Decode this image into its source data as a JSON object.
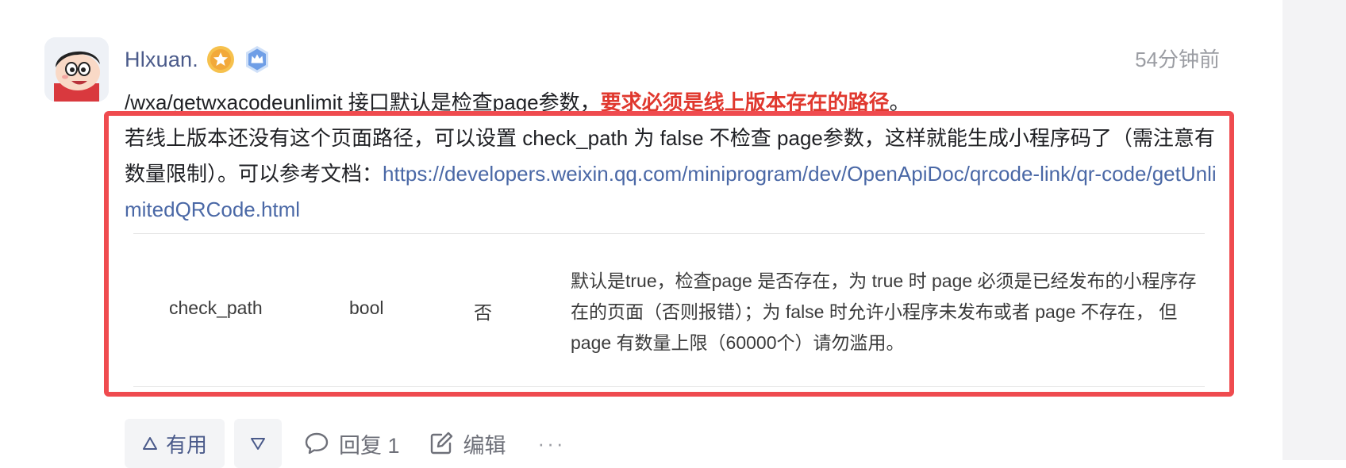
{
  "comment": {
    "author": "Hlxuan.",
    "timestamp": "54分钟前",
    "line1_prefix": "/wxa/getwxacodeunlimit 接口默认是检查page参数，",
    "line1_emphasis": "要求必须是线上版本存在的路径",
    "line1_suffix": "。",
    "para_text": "若线上版本还没有这个页面路径，可以设置 check_path 为 false 不检查 page参数，这样就能生成小程序码了（需注意有数量限制）。可以参考文档：",
    "doc_link": "https://developers.weixin.qq.com/miniprogram/dev/OpenApiDoc/qrcode-link/qr-code/getUnlimitedQRCode.html"
  },
  "param_table": {
    "rows": [
      {
        "name": "check_path",
        "type": "bool",
        "required": "否",
        "description": "默认是true，检查page 是否存在，为 true 时 page 必须是已经发布的小程序存在的页面（否则报错）；为 false 时允许小程序未发布或者 page 不存在， 但page 有数量上限（60000个）请勿滥用。"
      }
    ]
  },
  "actions": {
    "useful_label": "有用",
    "reply_label": "回复 1",
    "edit_label": "编辑",
    "more_label": "···"
  },
  "colors": {
    "highlight_border": "#ef4b4f",
    "emphasis": "#e0382e",
    "link": "#4a68a6",
    "author": "#4a5a8a"
  },
  "icons": [
    "avatar-image",
    "gold-star-badge",
    "blue-crown-badge",
    "thumbs-up-triangle-icon",
    "down-triangle-icon",
    "comment-bubble-icon",
    "edit-pencil-icon",
    "more-dots-icon"
  ]
}
